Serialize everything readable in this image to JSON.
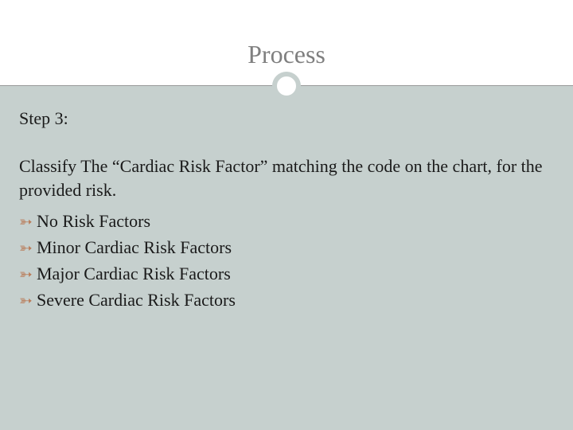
{
  "header": {
    "title": "Process"
  },
  "content": {
    "step_label": "Step 3:",
    "description": "Classify The “Cardiac Risk Factor” matching the code on the chart, for the provided risk.",
    "bullets": [
      "No Risk Factors",
      "Minor Cardiac Risk Factors",
      "Major Cardiac Risk Factors",
      "Severe Cardiac Risk Factors"
    ]
  },
  "colors": {
    "body_bg": "#c6d0ce",
    "title_gray": "#7f7f7f",
    "bullet_accent": "#b97a56"
  }
}
